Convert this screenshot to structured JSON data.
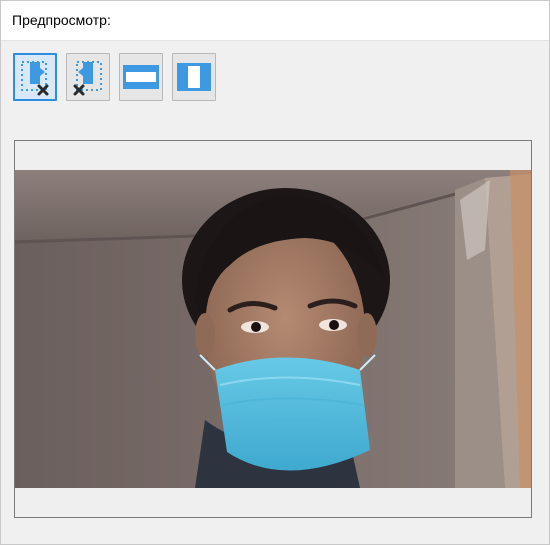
{
  "header": {
    "title": "Предпросмотр:"
  },
  "toolbar": {
    "buttons": [
      {
        "name": "fit-crop-clear-button",
        "icon": "selection-clear-icon",
        "active": true
      },
      {
        "name": "fit-crop-clear-alt-button",
        "icon": "selection-clear-alt-icon",
        "active": false
      },
      {
        "name": "fit-horizontal-button",
        "icon": "horizontal-band-icon",
        "active": false
      },
      {
        "name": "fit-vertical-button",
        "icon": "vertical-band-icon",
        "active": false
      }
    ]
  },
  "colors": {
    "accent": "#2d8ee0",
    "icon_blue": "#3d9ae2",
    "background": "#f0f0f0"
  },
  "preview": {
    "content": "webcam-photo"
  }
}
